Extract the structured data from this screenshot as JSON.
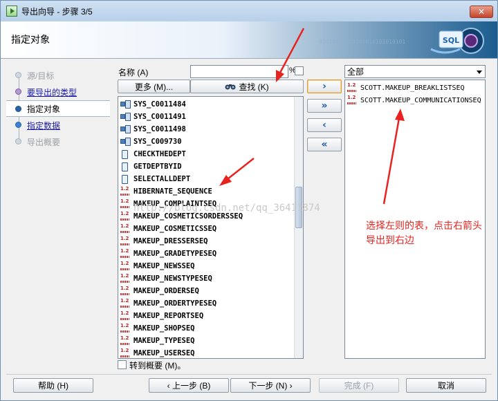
{
  "window": {
    "title": "导出向导 - 步骤 3/5",
    "close": "✕"
  },
  "header": {
    "title": "指定对象",
    "binary": "01010101010101010101010101",
    "logo_text": "SQL"
  },
  "steps": [
    {
      "label": "源/目标",
      "state": "disabled"
    },
    {
      "label": "要导出的类型",
      "state": "done"
    },
    {
      "label": "指定对象",
      "state": "active"
    },
    {
      "label": "指定数据",
      "state": "link"
    },
    {
      "label": "导出概要",
      "state": "disabled"
    }
  ],
  "search": {
    "name_label": "名称 (A)",
    "name_value": "",
    "wildcard": "%",
    "more_button": "更多 (M)...",
    "find_button": "查找 (K)"
  },
  "available_objects": [
    {
      "name": "SYS_C0011484",
      "icon": "table-icon"
    },
    {
      "name": "SYS_C0011491",
      "icon": "table-icon"
    },
    {
      "name": "SYS_C0011498",
      "icon": "table-icon"
    },
    {
      "name": "SYS_C009730",
      "icon": "table-icon"
    },
    {
      "name": "CHECKTHEDEPT",
      "icon": "procedure-icon"
    },
    {
      "name": "GETDEPTBYID",
      "icon": "procedure-icon"
    },
    {
      "name": "SELECTALLDEPT",
      "icon": "procedure-icon"
    },
    {
      "name": "HIBERNATE_SEQUENCE",
      "icon": "sequence-icon"
    },
    {
      "name": "MAKEUP_COMPLAINTSEQ",
      "icon": "sequence-icon"
    },
    {
      "name": "MAKEUP_COSMETICSORDERSSEQ",
      "icon": "sequence-icon"
    },
    {
      "name": "MAKEUP_COSMETICSSEQ",
      "icon": "sequence-icon"
    },
    {
      "name": "MAKEUP_DRESSERSEQ",
      "icon": "sequence-icon"
    },
    {
      "name": "MAKEUP_GRADETYPESEQ",
      "icon": "sequence-icon"
    },
    {
      "name": "MAKEUP_NEWSSEQ",
      "icon": "sequence-icon"
    },
    {
      "name": "MAKEUP_NEWSTYPESEQ",
      "icon": "sequence-icon"
    },
    {
      "name": "MAKEUP_ORDERSEQ",
      "icon": "sequence-icon"
    },
    {
      "name": "MAKEUP_ORDERTYPESEQ",
      "icon": "sequence-icon"
    },
    {
      "name": "MAKEUP_REPORTSEQ",
      "icon": "sequence-icon"
    },
    {
      "name": "MAKEUP_SHOPSEQ",
      "icon": "sequence-icon"
    },
    {
      "name": "MAKEUP_TYPESEQ",
      "icon": "sequence-icon"
    },
    {
      "name": "MAKEUP_USERSEQ",
      "icon": "sequence-icon"
    }
  ],
  "move_buttons": {
    "add": "›",
    "add_all": "»",
    "remove": "‹",
    "remove_all": "«"
  },
  "filter": {
    "selected": "全部"
  },
  "selected_objects": [
    {
      "name": "SCOTT.MAKEUP_BREAKLISTSEQ",
      "icon": "sequence-icon"
    },
    {
      "name": "SCOTT.MAKEUP_COMMUNICATIONSEQ",
      "icon": "sequence-icon"
    }
  ],
  "watermark": "http://blog.csdn.net/qq_36411874",
  "annotation": "选择左则的表，点击右箭头导出到右边",
  "summary_checkbox": "转到概要 (M)。",
  "footer": {
    "help": "帮助 (H)",
    "back": "‹ 上一步 (B)",
    "next": "下一步 (N) ›",
    "finish": "完成 (F)",
    "cancel": "取消"
  },
  "colors": {
    "annotation": "#e8231f",
    "link": "#1a1aa6",
    "accent": "#1b56b0"
  }
}
